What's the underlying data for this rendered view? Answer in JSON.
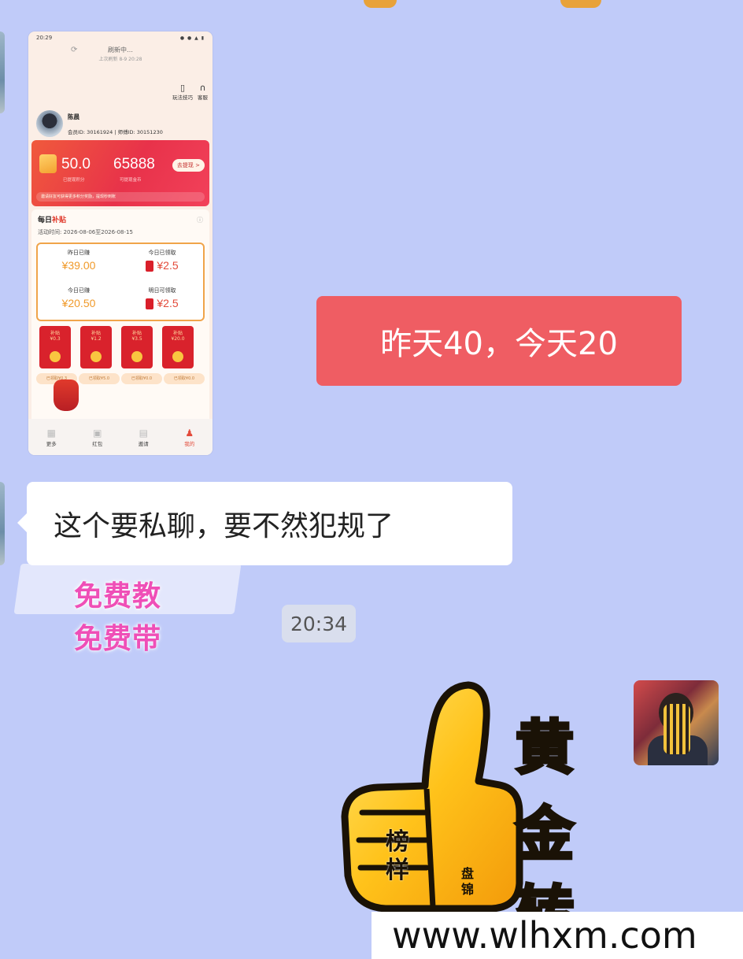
{
  "screenshot": {
    "status_time": "20:29",
    "status_icons": "● ● ▲ ▮",
    "refresh_label": "刷新中…",
    "refresh_sub": "上次刷新 8-9 20:28",
    "tools": [
      {
        "icon": "phone-icon",
        "label": "玩法技巧"
      },
      {
        "icon": "headset-icon",
        "label": "客服"
      }
    ],
    "user_name": "陈晨",
    "user_ids": "会员ID: 30161924 | 师傅ID: 30151230",
    "banner_value1": "50.0",
    "banner_value2": "65888",
    "banner_sub1": "已提现积分",
    "banner_sub2": "可提现金币",
    "withdraw_label": "去提现 >",
    "banner_tip": "邀请好友可获得更多积分奖励，提现秒到账",
    "daily_title_a": "每日",
    "daily_title_b": "补贴",
    "daily_date": "活动时间: 2026-08-06至2026-08-15",
    "cells": [
      {
        "label": "昨日已赚",
        "value": "¥39.00"
      },
      {
        "label": "今日已领取",
        "value": "¥2.5"
      },
      {
        "label": "今日已赚",
        "value": "¥20.50"
      },
      {
        "label": "明日可领取",
        "value": "¥2.5"
      }
    ],
    "packs": [
      {
        "label": "补贴",
        "value": "¥0.3"
      },
      {
        "label": "补贴",
        "value": "¥1.2"
      },
      {
        "label": "补贴",
        "value": "¥3.5"
      },
      {
        "label": "补贴",
        "value": "¥20.0"
      }
    ],
    "pack_labels": [
      "已领取¥0.3",
      "已领取¥5.0",
      "已领取¥0.0",
      "已领取¥0.0"
    ],
    "tabs": [
      {
        "icon": "grid-icon",
        "label": "更多",
        "active": false
      },
      {
        "icon": "redpacket-icon",
        "label": "红包",
        "active": false
      },
      {
        "icon": "invite-icon",
        "label": "邀请",
        "active": false
      },
      {
        "icon": "profile-icon",
        "label": "我的",
        "active": true
      }
    ]
  },
  "messages": {
    "outgoing_text": "昨天40，今天20",
    "incoming_text": "这个要私聊，要不然犯规了",
    "sticker_line1": "免费教",
    "sticker_line2": "免费带",
    "timestamp": "20:34"
  },
  "thumbs_sticker": {
    "chars": [
      "黄",
      "金",
      "转"
    ],
    "small_chars": [
      "榜",
      "样"
    ],
    "tiny_chars": [
      "盘",
      "锦"
    ]
  },
  "watermark": "www.wlhxm.com",
  "colors": {
    "background": "#c0cbf9",
    "outgoing_bubble": "#ef5d63",
    "incoming_bubble": "#ffffff",
    "sticker_pink": "#ef4fb7",
    "gold": "#ffc81e"
  }
}
